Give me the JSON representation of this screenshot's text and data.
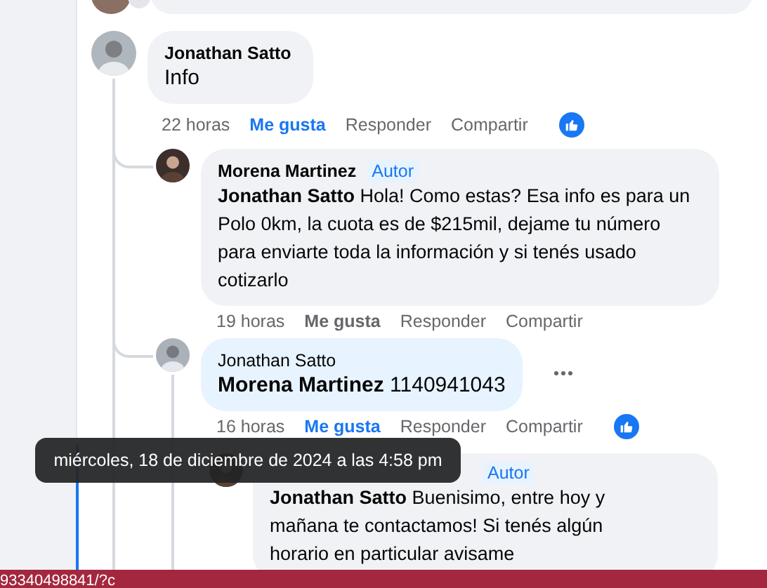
{
  "comments": [
    {
      "author": "Jonathan Satto",
      "text": "Info",
      "time": "22 horas",
      "like_label": "Me gusta",
      "liked": true,
      "reply_label": "Responder",
      "share_label": "Compartir",
      "has_reaction": true,
      "children": [
        {
          "author": "Morena Martinez",
          "badge": "Autor",
          "mention": "Jonathan Satto",
          "text": "Hola! Como estas? Esa info es para un Polo 0km, la cuota es de $215mil, dejame tu número para enviarte toda la información y si tenés usado cotizarlo",
          "time": "19 horas",
          "like_label": "Me gusta",
          "liked": false,
          "reply_label": "Responder",
          "share_label": "Compartir",
          "has_reaction": false
        },
        {
          "author": "Jonathan Satto",
          "mention": "Morena Martinez",
          "text": "1140941043",
          "highlighted": true,
          "more": true,
          "time": "16 horas",
          "like_label": "Me gusta",
          "liked": true,
          "reply_label": "Responder",
          "share_label": "Compartir",
          "has_reaction": true,
          "children": [
            {
              "badge": "Autor",
              "mention": "Jonathan Satto",
              "text": "Buenisimo, entre hoy y mañana te contactamos! Si tenés algún horario en particular avisame"
            }
          ]
        }
      ]
    }
  ],
  "tooltip": {
    "text": "miércoles, 18 de diciembre de 2024 a las 4:58 pm"
  },
  "status_bar": {
    "url": "93340498841/?c"
  }
}
